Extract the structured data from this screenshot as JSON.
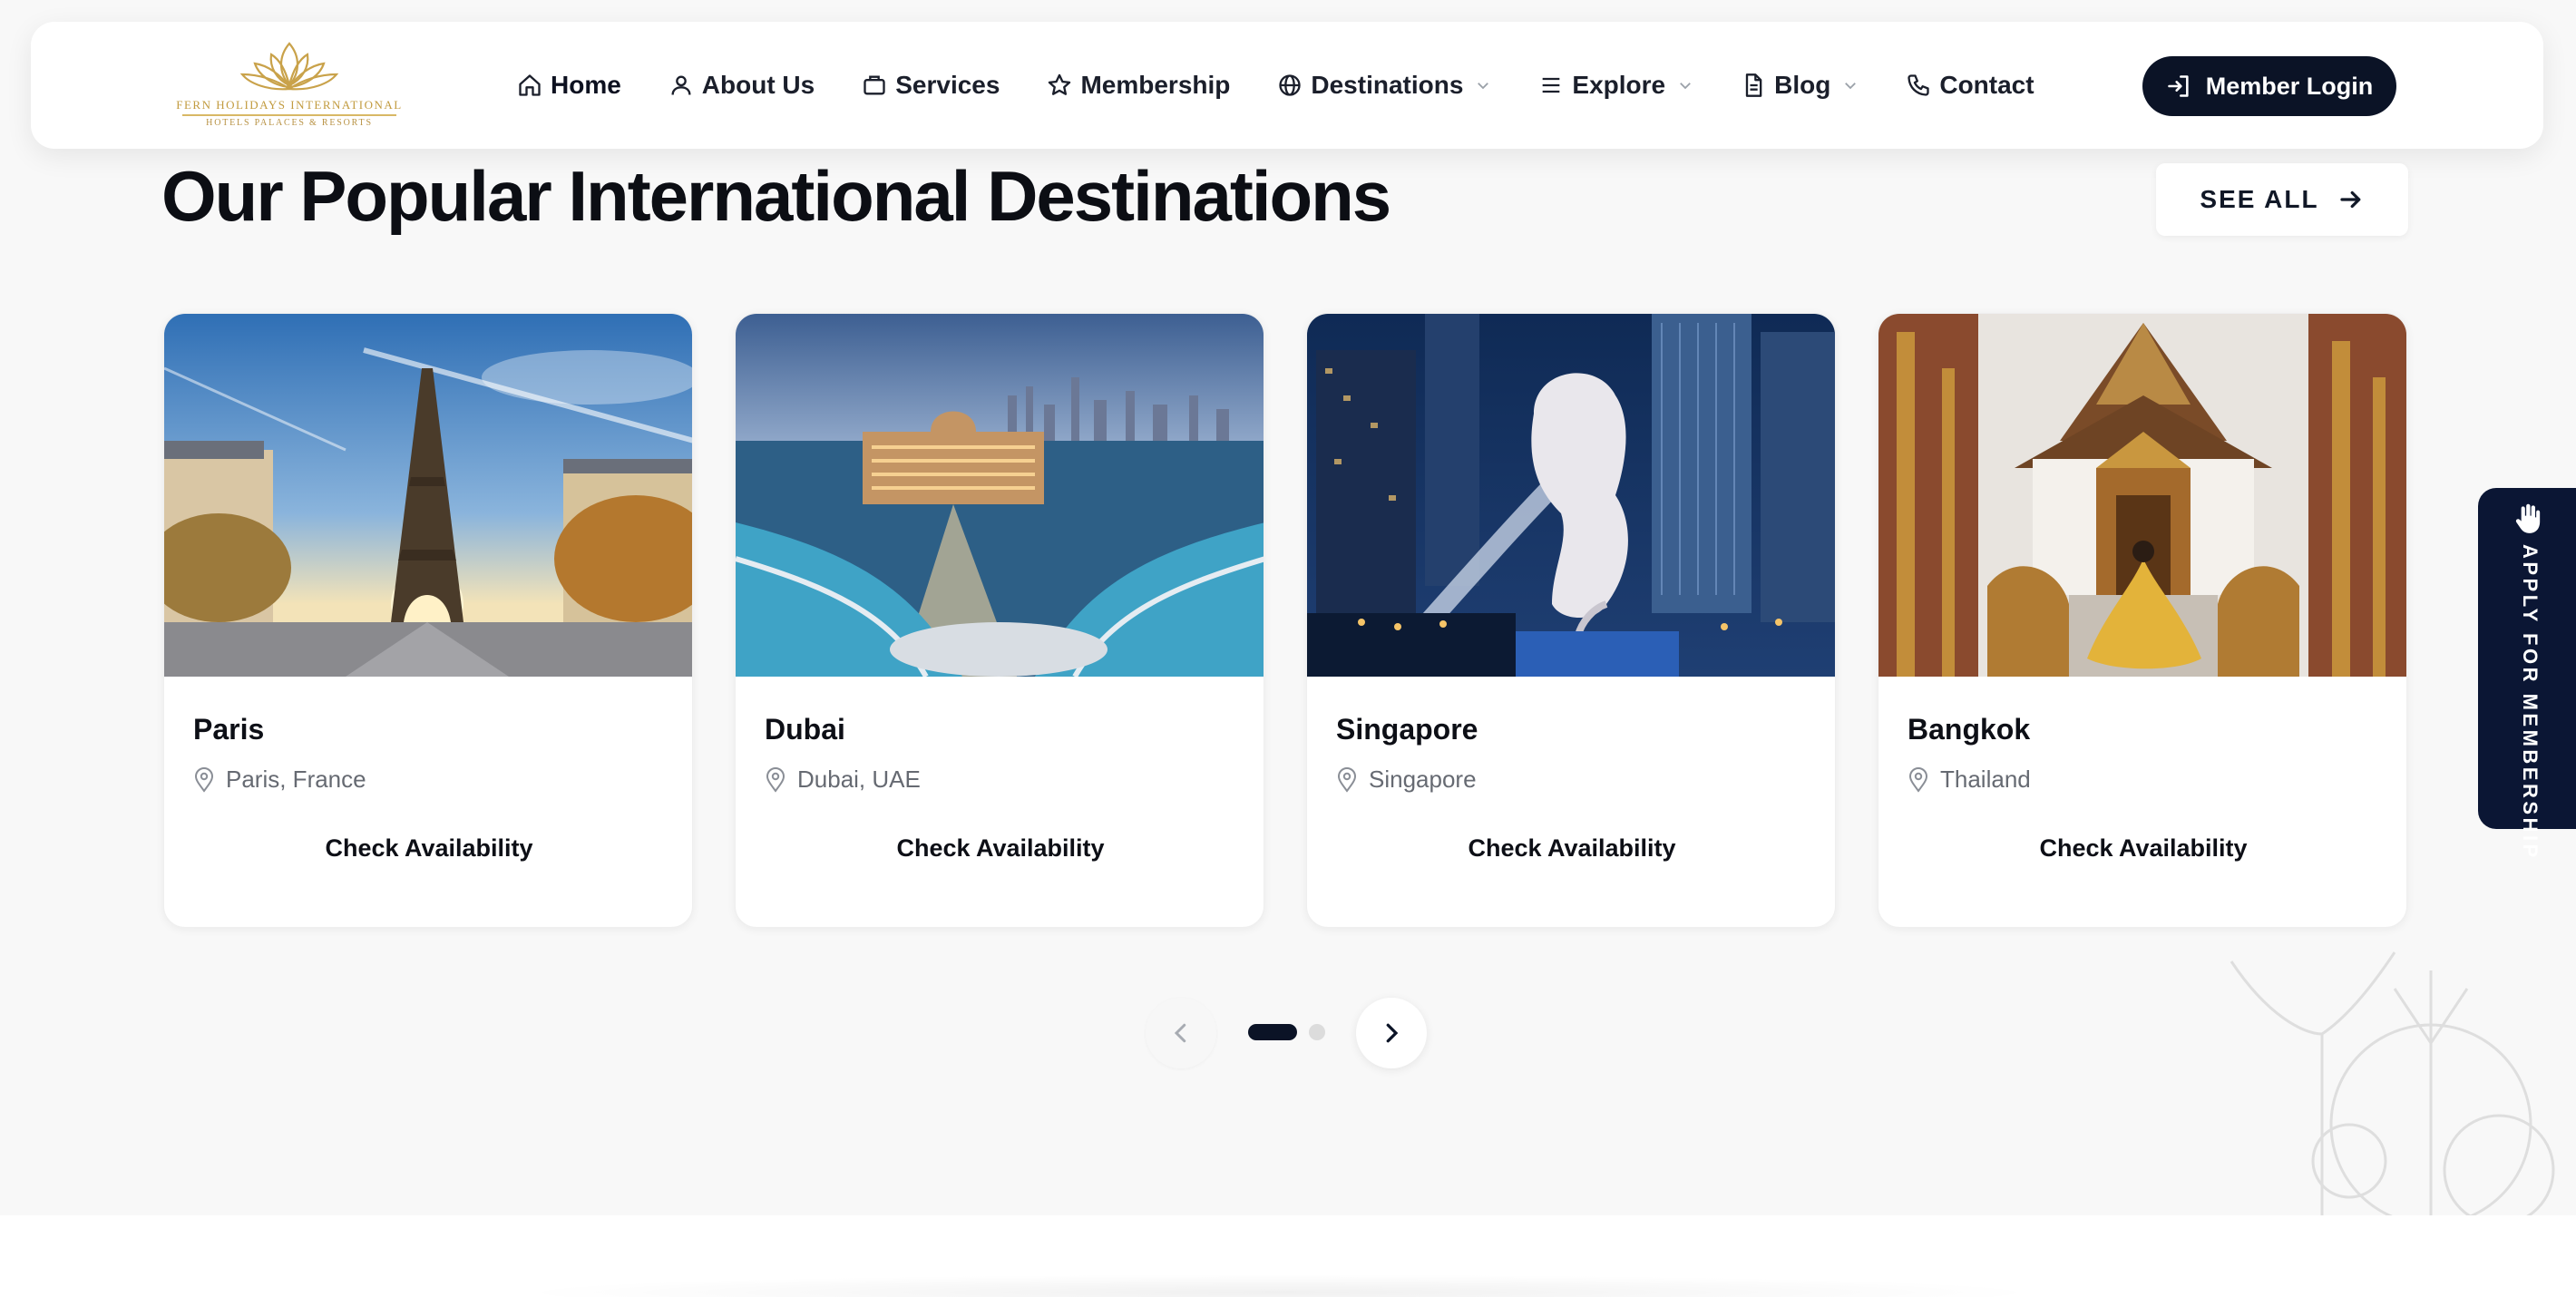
{
  "logo": {
    "title": "FERN HOLIDAYS INTERNATIONAL",
    "subtitle": "HOTELS PALACES & RESORTS"
  },
  "nav": {
    "items": [
      {
        "label": "Home",
        "icon": "home-icon"
      },
      {
        "label": "About Us",
        "icon": "user-icon"
      },
      {
        "label": "Services",
        "icon": "briefcase-icon"
      },
      {
        "label": "Membership",
        "icon": "star-icon"
      },
      {
        "label": "Destinations",
        "icon": "globe-icon",
        "dropdown": true
      },
      {
        "label": "Explore",
        "icon": "menu-icon",
        "dropdown": true
      },
      {
        "label": "Blog",
        "icon": "document-icon",
        "dropdown": true
      },
      {
        "label": "Contact",
        "icon": "phone-icon"
      }
    ],
    "login_label": "Member Login"
  },
  "section": {
    "heading": "Our Popular International Destinations",
    "see_all": "SEE ALL"
  },
  "cards": [
    {
      "title": "Paris",
      "location": "Paris, France",
      "cta": "Check Availability"
    },
    {
      "title": "Dubai",
      "location": "Dubai, UAE",
      "cta": "Check Availability"
    },
    {
      "title": "Singapore",
      "location": "Singapore",
      "cta": "Check Availability"
    },
    {
      "title": "Bangkok",
      "location": "Thailand",
      "cta": "Check Availability"
    }
  ],
  "pagination": {
    "pages": 2,
    "current": 1
  },
  "side_tab": {
    "label": "APPLY FOR MEMBERSHIP"
  },
  "colors": {
    "primary": "#0b1326",
    "gold": "#c29b3f",
    "background": "#f8f8f8",
    "muted_text": "#666a72"
  }
}
